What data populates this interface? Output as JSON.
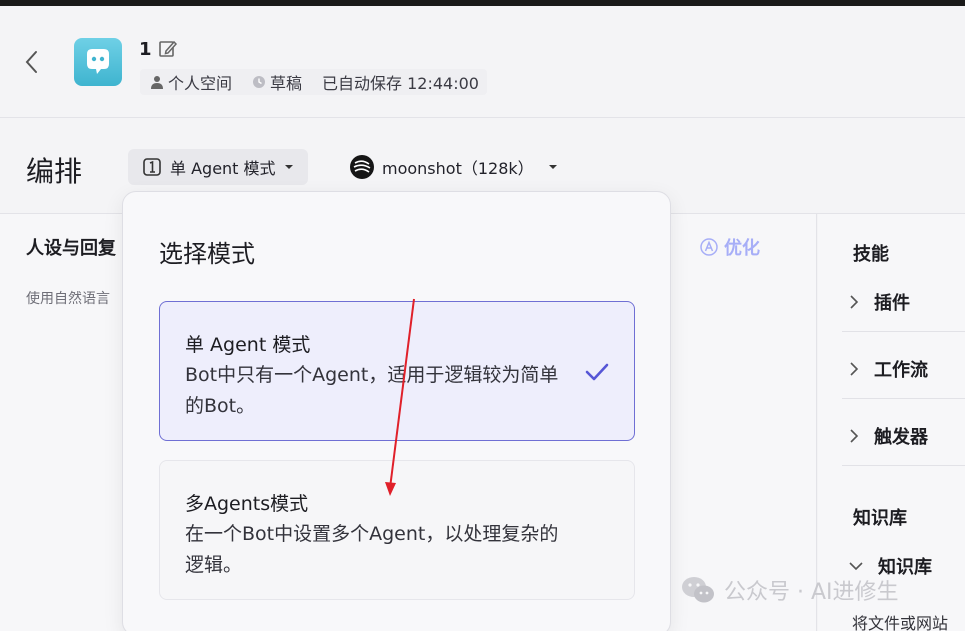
{
  "header": {
    "bot_title": "1",
    "space": "个人空间",
    "status": "草稿",
    "autosave": "已自动保存 12:44:00"
  },
  "toolbar": {
    "page_title": "编排",
    "mode_label": "单 Agent 模式",
    "model_label": "moonshot（128k）"
  },
  "left_panel": {
    "section_title": "人设与回复",
    "section_desc": "使用自然语言",
    "optimize_label": "优化"
  },
  "right_panel": {
    "skills_heading": "技能",
    "items": [
      "插件",
      "工作流",
      "触发器"
    ],
    "knowledge_heading": "知识库",
    "knowledge_item": "知识库",
    "knowledge_sub": "将文件或网站"
  },
  "popover": {
    "title": "选择模式",
    "options": [
      {
        "name": "单 Agent 模式",
        "desc": "Bot中只有一个Agent，适用于逻辑较为简单的Bot。",
        "selected": true
      },
      {
        "name": "多Agents模式",
        "desc": "在一个Bot中设置多个Agent，以处理复杂的逻辑。",
        "selected": false
      }
    ]
  },
  "watermark": {
    "text": "公众号 · AI进修生"
  },
  "colors": {
    "accent": "#6f6fd4",
    "check": "#5656d6",
    "optimize": "#a7aef7",
    "annotation": "#e0202a"
  }
}
